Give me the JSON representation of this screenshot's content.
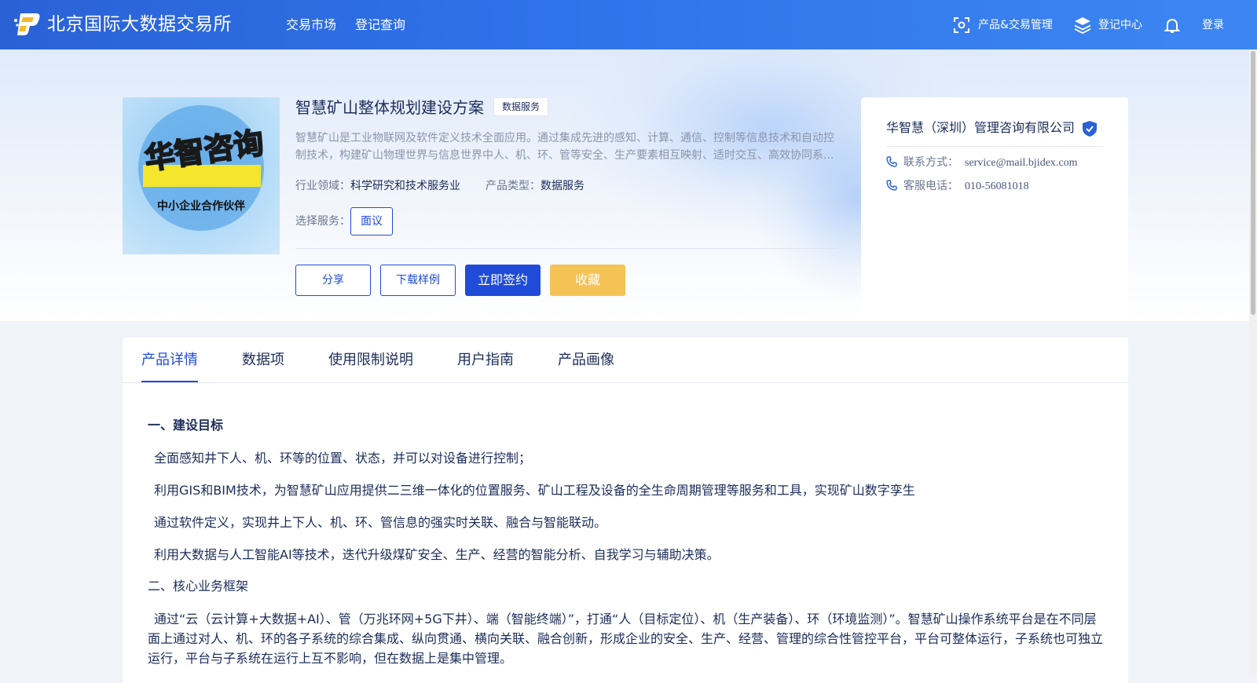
{
  "header": {
    "brand": "北京国际大数据交易所",
    "nav": [
      "交易市场",
      "登记查询"
    ],
    "right": {
      "product_mgmt": "产品&交易管理",
      "register_center": "登记中心",
      "login": "登录"
    }
  },
  "product": {
    "title": "智慧矿山整体规划建设方案",
    "tag": "数据服务",
    "image": {
      "title": "华智咨询",
      "subtitle": "中小企业合作伙伴"
    },
    "description_line1": "智慧矿山是工业物联网及软件定义技术全面应用。通过集成先进的感知、计算、通信、控制等信息技术和自动控",
    "description_line2": "制技术，构建矿山物理世界与信息世界中人、机、环、管等安全、生产要素相互映射、适时交互、高效协同系...",
    "industry_label": "行业领域：",
    "industry_value": "科学研究和技术服务业",
    "type_label": "产品类型：",
    "type_value": "数据服务",
    "service_label": "选择服务：",
    "service_option": "面议",
    "buttons": {
      "share": "分享",
      "download": "下载样例",
      "sign": "立即签约",
      "favorite": "收藏"
    }
  },
  "vendor": {
    "name": "华智慧（深圳）管理咨询有限公司",
    "contact_label": "联系方式：",
    "contact_value": "service@mail.bjidex.com",
    "phone_label": "客服电话：",
    "phone_value": "010-56081018"
  },
  "tabs": [
    "产品详情",
    "数据项",
    "使用限制说明",
    "用户指南",
    "产品画像"
  ],
  "active_tab": "产品详情",
  "detail": {
    "section1_title": "一、建设目标",
    "p1": "全面感知井下人、机、环等的位置、状态，并可以对设备进行控制；",
    "p2": "利用GIS和BIM技术，为智慧矿山应用提供二三维一体化的位置服务、矿山工程及设备的全生命周期管理等服务和工具，实现矿山数字孪生",
    "p3": "通过软件定义，实现井上下人、机、环、管信息的强实时关联、融合与智能联动。",
    "p4": "利用大数据与人工智能AI等技术，迭代升级煤矿安全、生产、经营的智能分析、自我学习与辅助决策。",
    "section2_title": "二、核心业务框架",
    "p5": "通过“云（云计算+大数据+AI）、管（万兆环网+5G下井）、端（智能终端）”，打通“人（目标定位）、机（生产装备）、环（环境监测）”。智慧矿山操作系统平台是在不同层面上通过对人、机、环的各子系统的综合集成、纵向贯通、横向关联、融合创新，形成企业的安全、生产、经营、管理的综合性管控平台，平台可整体运行，子系统也可独立运行，平台与子系统在运行上互不影响，但在数据上是集中管理。"
  },
  "colors": {
    "primary": "#1f4bd8",
    "favorite": "#f5c256",
    "header_gradient_start": "#2a62d6",
    "header_gradient_end": "#3d86f2"
  },
  "icons": [
    "logo-icon",
    "scan-icon",
    "layers-icon",
    "bell-icon",
    "verified-badge-icon",
    "phone-icon"
  ]
}
